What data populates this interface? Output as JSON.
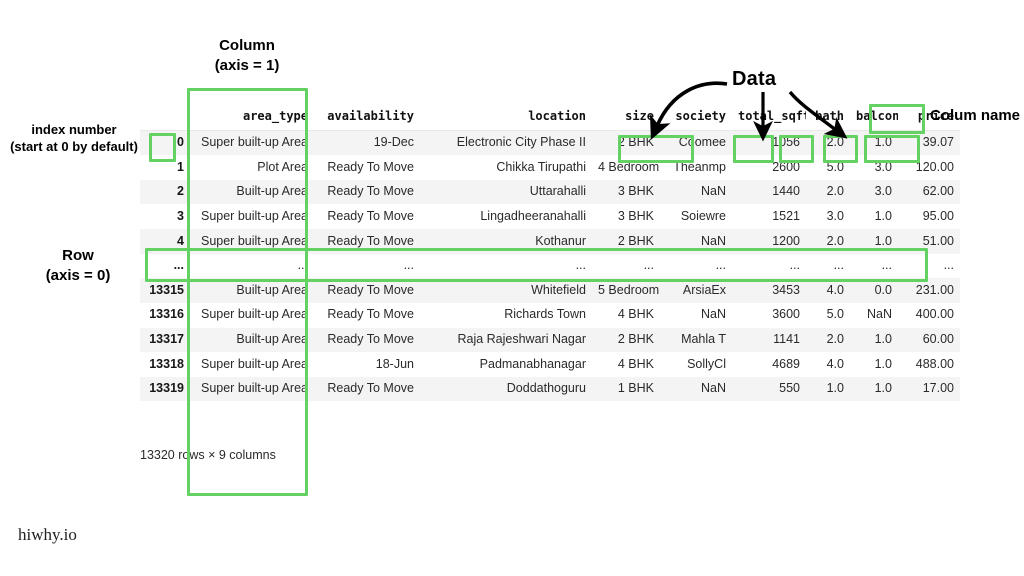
{
  "watermark": "hiwhy.io",
  "annotations": {
    "index_number": "index number\n(start at 0 by default)",
    "index_number_line1": "index number",
    "index_number_line2": "(start at 0 by default)",
    "row_line1": "Row",
    "row_line2": "(axis = 0)",
    "column_line1": "Column",
    "column_line2": "(axis = 1)",
    "data": "Data",
    "column_name": "Colum name",
    "highlight_color": "#63d263"
  },
  "table": {
    "index_header": "",
    "columns": [
      "area_type",
      "availability",
      "location",
      "size",
      "society",
      "total_sqft",
      "bath",
      "balcony",
      "price"
    ],
    "rows": [
      {
        "index": "0",
        "cells": [
          "Super built-up Area",
          "19-Dec",
          "Electronic City Phase II",
          "2 BHK",
          "Coomee",
          "1056",
          "2.0",
          "1.0",
          "39.07"
        ]
      },
      {
        "index": "1",
        "cells": [
          "Plot Area",
          "Ready To Move",
          "Chikka Tirupathi",
          "4 Bedroom",
          "Theanmp",
          "2600",
          "5.0",
          "3.0",
          "120.00"
        ]
      },
      {
        "index": "2",
        "cells": [
          "Built-up Area",
          "Ready To Move",
          "Uttarahalli",
          "3 BHK",
          "NaN",
          "1440",
          "2.0",
          "3.0",
          "62.00"
        ]
      },
      {
        "index": "3",
        "cells": [
          "Super built-up Area",
          "Ready To Move",
          "Lingadheeranahalli",
          "3 BHK",
          "Soiewre",
          "1521",
          "3.0",
          "1.0",
          "95.00"
        ]
      },
      {
        "index": "4",
        "cells": [
          "Super built-up Area",
          "Ready To Move",
          "Kothanur",
          "2 BHK",
          "NaN",
          "1200",
          "2.0",
          "1.0",
          "51.00"
        ]
      },
      {
        "index": "...",
        "cells": [
          "...",
          "...",
          "...",
          "...",
          "...",
          "...",
          "...",
          "...",
          "..."
        ]
      },
      {
        "index": "13315",
        "cells": [
          "Built-up Area",
          "Ready To Move",
          "Whitefield",
          "5 Bedroom",
          "ArsiaEx",
          "3453",
          "4.0",
          "0.0",
          "231.00"
        ]
      },
      {
        "index": "13316",
        "cells": [
          "Super built-up Area",
          "Ready To Move",
          "Richards Town",
          "4 BHK",
          "NaN",
          "3600",
          "5.0",
          "NaN",
          "400.00"
        ]
      },
      {
        "index": "13317",
        "cells": [
          "Built-up Area",
          "Ready To Move",
          "Raja Rajeshwari Nagar",
          "2 BHK",
          "Mahla T",
          "1141",
          "2.0",
          "1.0",
          "60.00"
        ]
      },
      {
        "index": "13318",
        "cells": [
          "Super built-up Area",
          "18-Jun",
          "Padmanabhanagar",
          "4 BHK",
          "SollyCl",
          "4689",
          "4.0",
          "1.0",
          "488.00"
        ]
      },
      {
        "index": "13319",
        "cells": [
          "Super built-up Area",
          "Ready To Move",
          "Doddathoguru",
          "1 BHK",
          "NaN",
          "550",
          "1.0",
          "1.0",
          "17.00"
        ]
      }
    ],
    "shape_note": "13320 rows × 9 columns"
  }
}
